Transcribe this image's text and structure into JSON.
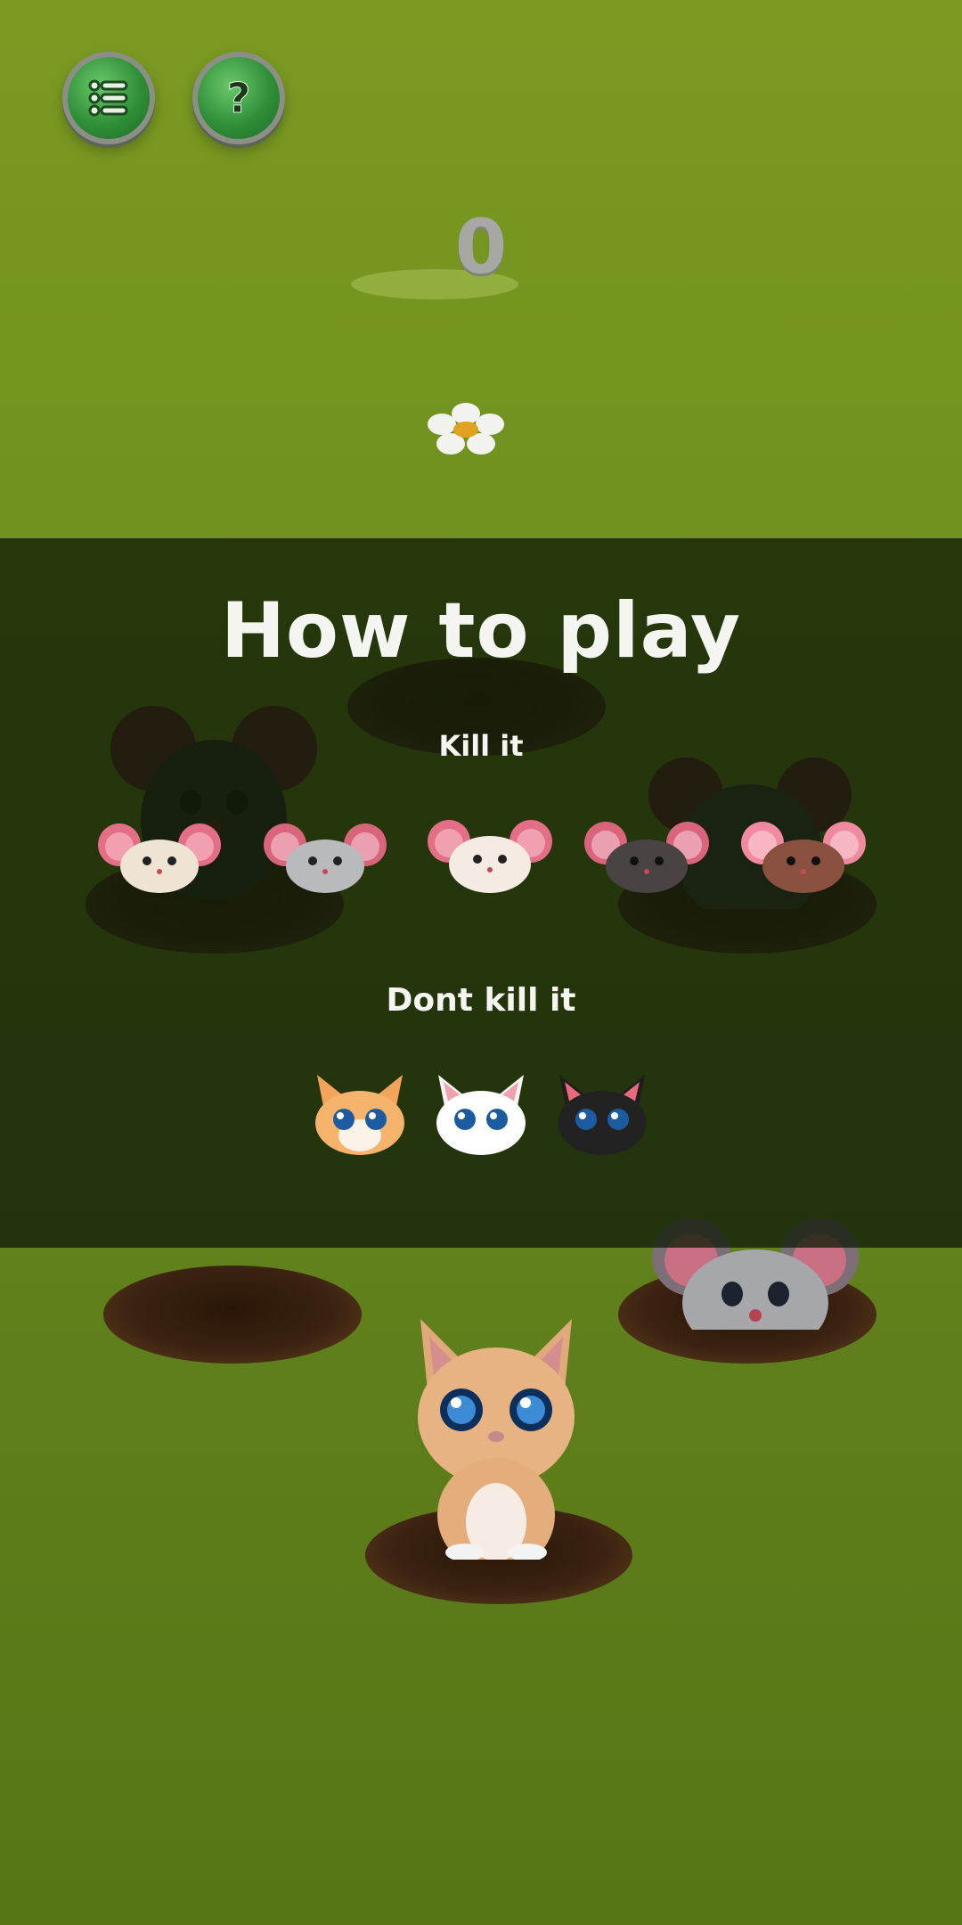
{
  "hud": {
    "menu_icon": "list-icon",
    "help_icon": "question-icon",
    "score": "0"
  },
  "howto": {
    "title": "How to play",
    "kill_label": "Kill it",
    "dont_kill_label": "Dont kill it"
  },
  "colors": {
    "grass_top": "#7a9a22",
    "grass_bottom": "#567616",
    "overlay": "rgba(18,30,8,0.78)",
    "button_green": "#2f8f38",
    "button_ring": "#8b8f86",
    "text_white": "#f4f4f0",
    "score_grey": "#a7a8a4"
  },
  "kill_it_characters": [
    "cream-mouse-icon",
    "grey-mouse-icon",
    "cream-mouse-icon",
    "dark-mouse-icon",
    "brown-mouse-icon"
  ],
  "dont_kill_it_characters": [
    "orange-cat-icon",
    "white-cat-icon",
    "black-cat-icon"
  ]
}
